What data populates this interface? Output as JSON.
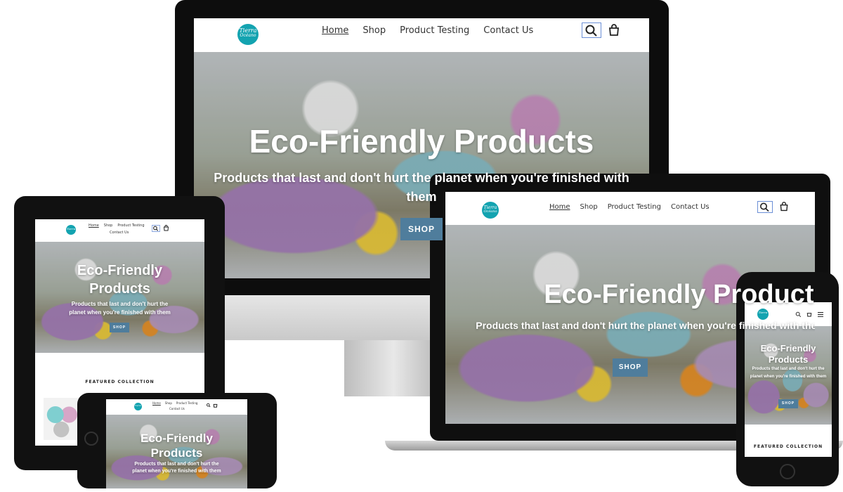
{
  "site": {
    "logo_line1": "Tierra",
    "logo_line2": "Océano",
    "nav": [
      "Home",
      "Shop",
      "Product Testing",
      "Contact Us"
    ],
    "hero_title": "Eco-Friendly Products",
    "hero_title_line1": "Eco-Friendly",
    "hero_title_line2": "Products",
    "hero_subtitle": "Products that last and don't hurt the planet when you're finished with them",
    "hero_subtitle_line1": "Products that last and don't hurt the",
    "hero_subtitle_line2": "planet when you're finished with them",
    "shop_button": "SHOP",
    "featured": "FEATURED COLLECTION"
  },
  "icons": [
    "search-icon",
    "cart-icon",
    "menu-icon"
  ],
  "colors": {
    "logo": "#13a3b0",
    "button": "#4f7d9c",
    "device_frame": "#111111"
  }
}
